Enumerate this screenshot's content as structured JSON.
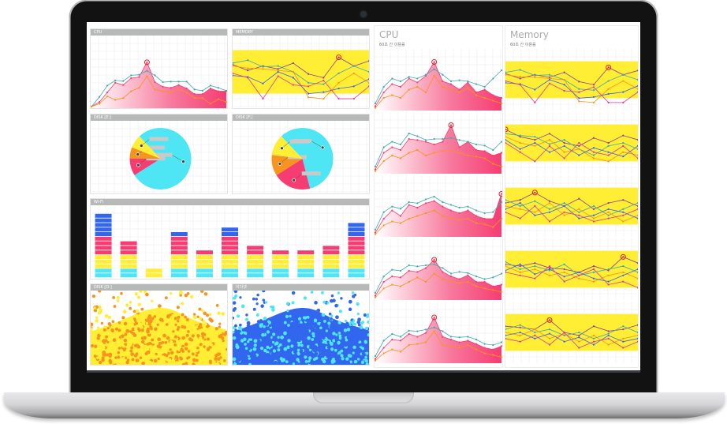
{
  "colors": {
    "pink": "#f53d73",
    "teal": "#3fa9ad",
    "orange": "#f7941d",
    "cyan": "#4ee6f5",
    "yellow": "#ffee33",
    "blue": "#3366ee",
    "purple": "#8e3d9c",
    "magenta": "#e0399a",
    "marker": "#ee1c25",
    "header": "#b7b9b9"
  },
  "panels": {
    "cpu": "CPU",
    "memory": "MEMORY",
    "disk_e": "DISK [E:]",
    "disk_f": "DISK [F:]",
    "wifi": "Wi-Fi",
    "disk_d": "DISK [D:]",
    "ethernet": "이더넷"
  },
  "right": {
    "cpu": {
      "title": "CPU",
      "subtitle": "60초 간 이용률"
    },
    "memory": {
      "title": "Memory",
      "subtitle": "60초 간 이용률"
    }
  },
  "chart_data": [
    {
      "id": "cpu",
      "type": "area",
      "ylim": [
        0,
        100
      ],
      "grid": true,
      "series": [
        {
          "color": "pink",
          "fill": true,
          "values": [
            0,
            8,
            25,
            42,
            38,
            50,
            52,
            78,
            43,
            35,
            33,
            38,
            32,
            22,
            22,
            32,
            27,
            27
          ]
        },
        {
          "color": "teal",
          "values": [
            0,
            17,
            37,
            46,
            45,
            55,
            56,
            63,
            55,
            43,
            44,
            44,
            44,
            30,
            28,
            37,
            33,
            28
          ]
        },
        {
          "color": "orange",
          "values": [
            0,
            5,
            18,
            12,
            15,
            27,
            33,
            53,
            30,
            27,
            25,
            30,
            25,
            15,
            15,
            5,
            13,
            8
          ]
        }
      ]
    },
    {
      "id": "memory",
      "type": "line",
      "ylim": [
        0,
        100
      ],
      "band": [
        20,
        80
      ],
      "grid": true,
      "peak_series": 0,
      "series": [
        {
          "color": "purple",
          "values": [
            60,
            52,
            58,
            54,
            62,
            47,
            42,
            70,
            58,
            65
          ]
        },
        {
          "color": "teal",
          "values": [
            62,
            66,
            57,
            58,
            50,
            35,
            33,
            48,
            58,
            50
          ]
        },
        {
          "color": "orange",
          "values": [
            58,
            55,
            54,
            52,
            50,
            15,
            13,
            35,
            48,
            35
          ]
        },
        {
          "color": "blue",
          "values": [
            45,
            43,
            34,
            50,
            42,
            20,
            22,
            27,
            30,
            40
          ]
        },
        {
          "color": "magenta",
          "values": [
            48,
            42,
            13,
            44,
            32,
            30,
            38,
            13,
            13,
            30
          ]
        }
      ]
    },
    {
      "id": "disk_e",
      "type": "pie",
      "slices": [
        {
          "color": "cyan",
          "value": 78
        },
        {
          "color": "pink",
          "value": 9
        },
        {
          "color": "orange",
          "value": 6
        },
        {
          "color": "yellow",
          "value": 7
        }
      ]
    },
    {
      "id": "disk_f",
      "type": "pie",
      "slices": [
        {
          "color": "cyan",
          "value": 58
        },
        {
          "color": "pink",
          "value": 20
        },
        {
          "color": "orange",
          "value": 11
        },
        {
          "color": "yellow",
          "value": 11
        }
      ]
    },
    {
      "id": "wifi",
      "type": "bar",
      "stacked": true,
      "segment_units": true,
      "series": [
        {
          "color": "cyan",
          "values": [
            2,
            2,
            0,
            2,
            2,
            2,
            2,
            2,
            2,
            2,
            2
          ]
        },
        {
          "color": "yellow",
          "values": [
            3,
            3,
            2,
            3,
            3,
            3,
            3,
            3,
            3,
            3,
            3
          ]
        },
        {
          "color": "pink",
          "values": [
            4,
            3,
            0,
            4,
            1,
            4,
            2,
            1,
            1,
            2,
            4
          ]
        },
        {
          "color": "blue",
          "values": [
            5,
            0,
            0,
            1,
            0,
            2,
            0,
            0,
            0,
            0,
            3
          ]
        }
      ]
    },
    {
      "id": "disk_d",
      "type": "scatter",
      "colors": [
        "orange",
        "yellow"
      ],
      "background": "yellow"
    },
    {
      "id": "ethernet",
      "type": "scatter",
      "colors": [
        "blue",
        "cyan"
      ],
      "background": "blue"
    },
    {
      "id": "right_cpu",
      "type": "area",
      "ylim": [
        0,
        100
      ],
      "charts": [
        {
          "pink": [
            5,
            30,
            45,
            40,
            55,
            48,
            60,
            85,
            50,
            45,
            35,
            48,
            30,
            35,
            25,
            20
          ],
          "teal": [
            10,
            40,
            55,
            50,
            58,
            55,
            62,
            72,
            62,
            50,
            52,
            50,
            45,
            40,
            55,
            70
          ],
          "orange": [
            2,
            20,
            25,
            20,
            35,
            40,
            30,
            60,
            40,
            35,
            30,
            38,
            25,
            20,
            15,
            10
          ]
        },
        {
          "pink": [
            5,
            35,
            45,
            40,
            60,
            58,
            55,
            50,
            55,
            85,
            45,
            55,
            40,
            38,
            30,
            35
          ],
          "teal": [
            10,
            45,
            55,
            50,
            70,
            65,
            58,
            60,
            60,
            62,
            58,
            55,
            50,
            48,
            40,
            55
          ],
          "orange": [
            2,
            20,
            30,
            25,
            35,
            40,
            30,
            35,
            38,
            40,
            35,
            30,
            28,
            25,
            15,
            10
          ]
        },
        {
          "pink": [
            5,
            30,
            45,
            35,
            55,
            50,
            58,
            62,
            52,
            45,
            40,
            45,
            35,
            30,
            30,
            75
          ],
          "teal": [
            10,
            42,
            52,
            48,
            60,
            58,
            65,
            70,
            60,
            55,
            50,
            52,
            45,
            40,
            42,
            60
          ],
          "orange": [
            2,
            18,
            25,
            22,
            30,
            35,
            40,
            45,
            35,
            30,
            28,
            30,
            22,
            20,
            15,
            30
          ]
        },
        {
          "pink": [
            5,
            30,
            40,
            38,
            50,
            48,
            55,
            70,
            48,
            40,
            35,
            42,
            30,
            30,
            22,
            25
          ],
          "teal": [
            10,
            40,
            52,
            50,
            60,
            58,
            60,
            62,
            55,
            45,
            48,
            46,
            40,
            35,
            38,
            45
          ],
          "orange": [
            2,
            18,
            25,
            22,
            30,
            38,
            30,
            45,
            35,
            30,
            28,
            30,
            22,
            18,
            15,
            12
          ]
        },
        {
          "pink": [
            5,
            25,
            40,
            38,
            50,
            45,
            52,
            80,
            45,
            40,
            35,
            38,
            32,
            25,
            22,
            28
          ],
          "teal": [
            10,
            38,
            50,
            45,
            56,
            55,
            58,
            62,
            55,
            45,
            44,
            45,
            40,
            32,
            30,
            35
          ],
          "orange": [
            2,
            15,
            22,
            18,
            30,
            32,
            35,
            55,
            30,
            28,
            25,
            30,
            22,
            15,
            12,
            8
          ]
        }
      ]
    },
    {
      "id": "right_memory",
      "type": "line",
      "ylim": [
        0,
        100
      ],
      "band": [
        20,
        80
      ],
      "charts": [
        [
          [
            60,
            52,
            58,
            54,
            62,
            47,
            42,
            70,
            58,
            65
          ],
          [
            62,
            66,
            57,
            58,
            50,
            35,
            33,
            48,
            58,
            50
          ],
          [
            58,
            55,
            54,
            52,
            50,
            15,
            13,
            35,
            48,
            35
          ],
          [
            45,
            43,
            34,
            50,
            42,
            20,
            22,
            27,
            30,
            40
          ],
          [
            48,
            42,
            13,
            44,
            32,
            30,
            38,
            13,
            13,
            30
          ]
        ],
        [
          [
            72,
            60,
            55,
            65,
            50,
            45,
            58,
            50,
            62,
            55
          ],
          [
            65,
            62,
            60,
            48,
            55,
            40,
            30,
            45,
            50,
            40
          ],
          [
            60,
            50,
            45,
            55,
            35,
            40,
            25,
            20,
            35,
            30
          ],
          [
            55,
            40,
            50,
            35,
            45,
            30,
            42,
            35,
            28,
            45
          ],
          [
            50,
            35,
            20,
            45,
            25,
            50,
            35,
            30,
            45,
            25
          ]
        ],
        [
          [
            55,
            60,
            72,
            58,
            50,
            62,
            45,
            55,
            60,
            50
          ],
          [
            60,
            50,
            58,
            45,
            55,
            40,
            50,
            35,
            45,
            55
          ],
          [
            50,
            45,
            40,
            55,
            35,
            45,
            30,
            40,
            25,
            35
          ],
          [
            45,
            55,
            35,
            40,
            50,
            30,
            35,
            45,
            40,
            30
          ],
          [
            40,
            30,
            50,
            25,
            40,
            35,
            25,
            30,
            35,
            45
          ]
        ],
        [
          [
            58,
            55,
            60,
            52,
            50,
            45,
            55,
            48,
            70,
            60
          ],
          [
            62,
            50,
            55,
            48,
            58,
            40,
            45,
            50,
            55,
            45
          ],
          [
            55,
            45,
            50,
            40,
            45,
            35,
            30,
            40,
            45,
            35
          ],
          [
            48,
            58,
            42,
            50,
            38,
            45,
            35,
            30,
            40,
            50
          ],
          [
            45,
            40,
            35,
            55,
            30,
            40,
            50,
            25,
            30,
            20
          ]
        ],
        [
          [
            60,
            58,
            55,
            70,
            50,
            45,
            60,
            52,
            55,
            62
          ],
          [
            55,
            62,
            50,
            55,
            45,
            50,
            40,
            48,
            60,
            50
          ],
          [
            50,
            45,
            55,
            40,
            48,
            35,
            45,
            30,
            40,
            45
          ],
          [
            45,
            50,
            40,
            48,
            35,
            42,
            30,
            45,
            35,
            40
          ],
          [
            40,
            35,
            45,
            30,
            50,
            25,
            35,
            40,
            25,
            35
          ]
        ]
      ]
    }
  ]
}
